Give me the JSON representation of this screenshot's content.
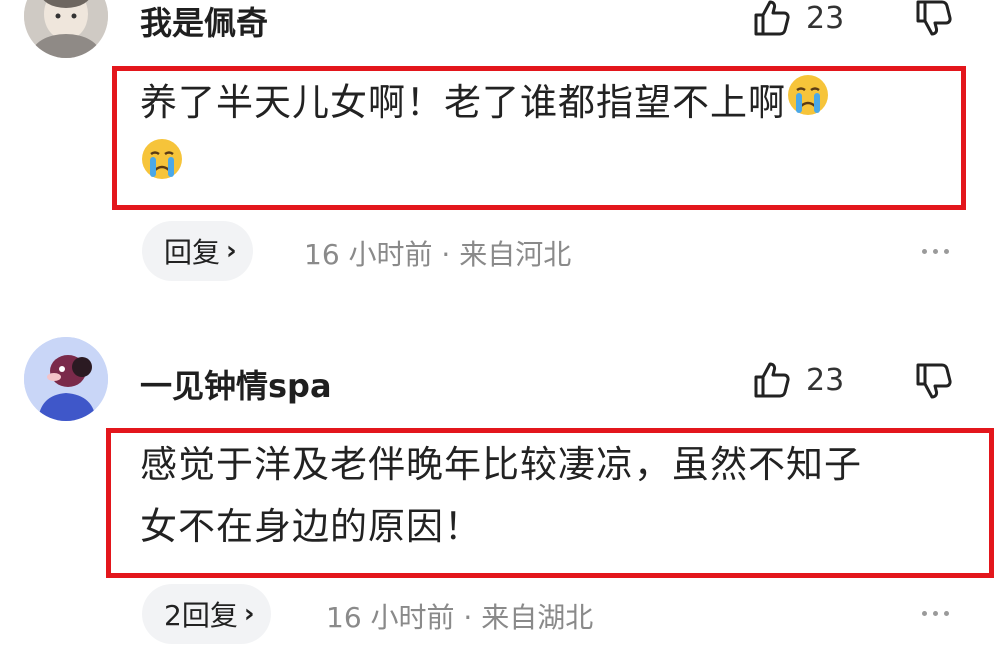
{
  "comments": [
    {
      "username": "我是佩奇",
      "likes": "23",
      "text_line1": "养了半天儿女啊！老了谁都指望不上啊",
      "reply_label": "回复",
      "meta": "16 小时前 · 来自河北"
    },
    {
      "username": "一见钟情spa",
      "likes": "23",
      "text_line1": "感觉于洋及老伴晚年比较凄凉，虽然不知子",
      "text_line2": "女不在身边的原因！",
      "reply_label": "2回复",
      "meta": "16 小时前 · 来自湖北"
    }
  ],
  "icons": {
    "like": "thumbs-up-icon",
    "dislike": "thumbs-down-icon",
    "more": "more-icon",
    "emoji": "crying-face-emoji",
    "chevron": "chevron-right-icon"
  },
  "colors": {
    "highlight_border": "#e3161c",
    "reply_bg": "#f2f3f5",
    "meta_text": "#8a8a8a"
  }
}
